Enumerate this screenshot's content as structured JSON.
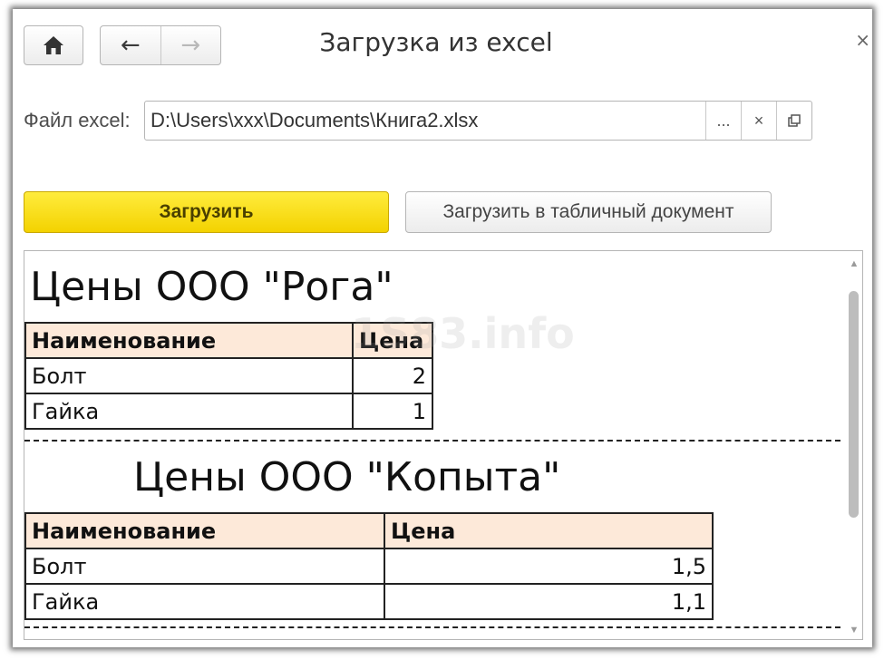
{
  "window": {
    "title": "Загрузка из excel",
    "home_icon": "home-icon",
    "back_icon": "arrow-left-icon",
    "forward_icon": "arrow-right-icon",
    "close_glyph": "×"
  },
  "form": {
    "file_label": "Файл excel:",
    "file_value": "D:\\Users\\xxx\\Documents\\Книга2.xlsx",
    "browse_glyph": "...",
    "clear_glyph": "×",
    "open_icon": "open-icon"
  },
  "actions": {
    "load_label": "Загрузить",
    "load_to_doc_label": "Загрузить в табличный документ",
    "primary_color": "#f5d800"
  },
  "watermark": "1S83.info",
  "sheet": {
    "header_fill": "#fde9d9",
    "tables": [
      {
        "title": "Цены ООО \"Рога\"",
        "columns": [
          "Наименование",
          "Цена"
        ],
        "rows": [
          [
            "Болт",
            "2"
          ],
          [
            "Гайка",
            "1"
          ]
        ]
      },
      {
        "title": "Цены ООО \"Копыта\"",
        "columns": [
          "Наименование",
          "Цена"
        ],
        "rows": [
          [
            "Болт",
            "1,5"
          ],
          [
            "Гайка",
            "1,1"
          ]
        ]
      }
    ]
  }
}
